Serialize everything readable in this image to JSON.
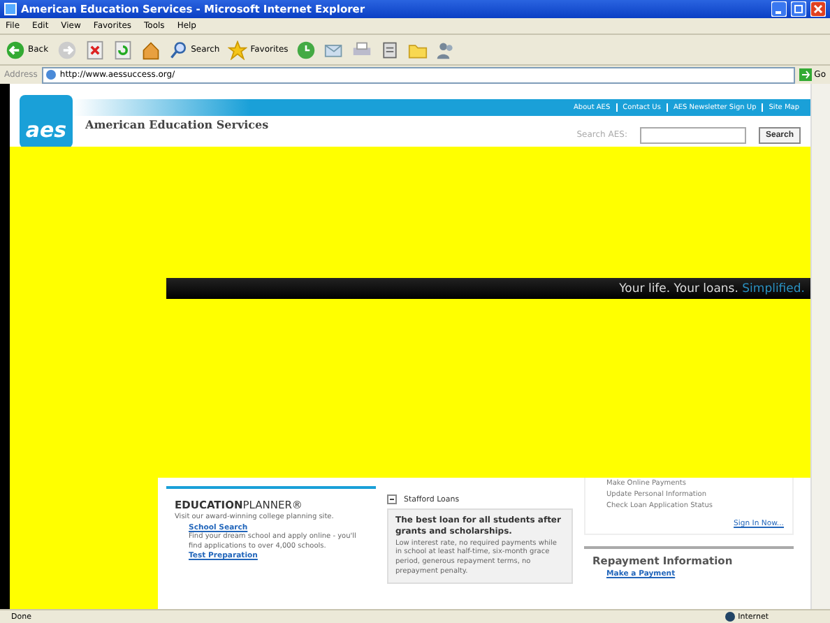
{
  "window": {
    "title": "American Education Services - Microsoft Internet Explorer"
  },
  "menu": [
    "File",
    "Edit",
    "View",
    "Favorites",
    "Tools",
    "Help"
  ],
  "toolbar": [
    {
      "kind": "back",
      "label": "Back"
    },
    {
      "kind": "forward"
    },
    {
      "kind": "stop"
    },
    {
      "kind": "refresh"
    },
    {
      "kind": "home"
    },
    {
      "kind": "search",
      "label": "Search"
    },
    {
      "kind": "favorites",
      "label": "Favorites"
    },
    {
      "kind": "history"
    },
    {
      "kind": "mail"
    },
    {
      "kind": "print"
    },
    {
      "kind": "edit"
    },
    {
      "kind": "folder"
    },
    {
      "kind": "messenger"
    }
  ],
  "address": {
    "label": "Address",
    "value": "http://www.aessuccess.org/",
    "go": "Go"
  },
  "page": {
    "top_links": [
      "About AES",
      "Contact Us",
      "AES Newsletter Sign Up",
      "Site Map"
    ],
    "logo": "aes",
    "site_title": "American Education Services",
    "search": {
      "label": "Search AES:",
      "button": "Search"
    },
    "banner": {
      "text": "Your life. Your loans.",
      "highlight": "Simplified."
    },
    "planner": {
      "logo": "**EDUCATION**PLANNER®",
      "intro": "Visit our award-winning college planning site.",
      "items": [
        {
          "title": "School Search",
          "text": "Find your dream school and apply online - you'll find applications to over 4,000 schools."
        },
        {
          "title": "Test Preparation"
        }
      ]
    },
    "stafford": {
      "title": "Stafford Loans",
      "expanded": true,
      "heading": "The best loan for all students after grants and scholarships.",
      "text": "Low interest rate, no required payments while in school at least half-time, six-month grace period, generous repayment terms, no prepayment penalty."
    },
    "account": {
      "items": [
        "Make Online Payments",
        "Update Personal Information",
        "Check Loan Application Status"
      ],
      "link": "Sign In Now..."
    },
    "repayment": {
      "title": "Repayment Information",
      "link": "Make a Payment"
    }
  },
  "status_bar": {
    "text": "Done",
    "zone": "Internet"
  }
}
